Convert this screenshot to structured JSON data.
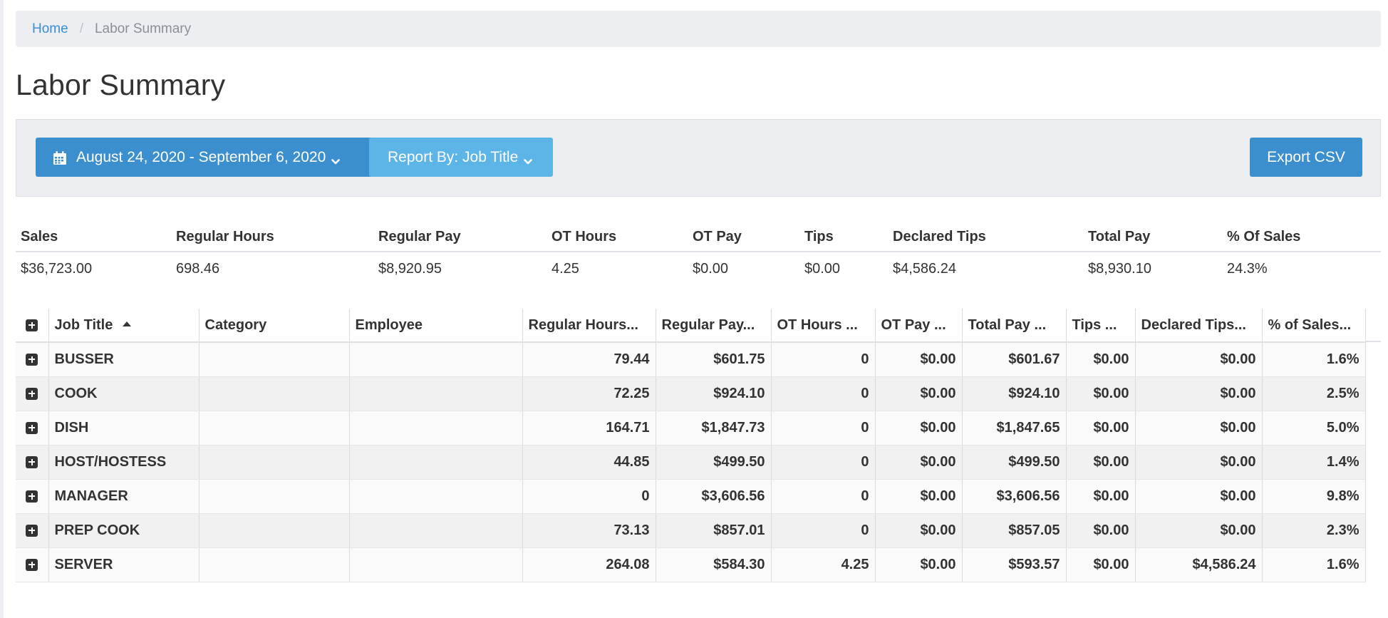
{
  "breadcrumb": {
    "home": "Home",
    "current": "Labor Summary"
  },
  "page_title": "Labor Summary",
  "toolbar": {
    "date_range": "August 24, 2020 - September 6, 2020",
    "report_by": "Report By: Job Title",
    "export": "Export CSV"
  },
  "summary": {
    "headers": [
      "Sales",
      "Regular Hours",
      "Regular Pay",
      "OT Hours",
      "OT Pay",
      "Tips",
      "Declared Tips",
      "Total Pay",
      "% Of Sales"
    ],
    "values": [
      "$36,723.00",
      "698.46",
      "$8,920.95",
      "4.25",
      "$0.00",
      "$0.00",
      "$4,586.24",
      "$8,930.10",
      "24.3%"
    ]
  },
  "grid": {
    "headers": [
      "Job Title",
      "Category",
      "Employee",
      "Regular Hours...",
      "Regular Pay...",
      "OT Hours ...",
      "OT Pay ...",
      "Total Pay ...",
      "Tips ...",
      "Declared Tips...",
      "% of Sales..."
    ],
    "rows": [
      [
        "BUSSER",
        "",
        "",
        "79.44",
        "$601.75",
        "0",
        "$0.00",
        "$601.67",
        "$0.00",
        "$0.00",
        "1.6%"
      ],
      [
        "COOK",
        "",
        "",
        "72.25",
        "$924.10",
        "0",
        "$0.00",
        "$924.10",
        "$0.00",
        "$0.00",
        "2.5%"
      ],
      [
        "DISH",
        "",
        "",
        "164.71",
        "$1,847.73",
        "0",
        "$0.00",
        "$1,847.65",
        "$0.00",
        "$0.00",
        "5.0%"
      ],
      [
        "HOST/HOSTESS",
        "",
        "",
        "44.85",
        "$499.50",
        "0",
        "$0.00",
        "$499.50",
        "$0.00",
        "$0.00",
        "1.4%"
      ],
      [
        "MANAGER",
        "",
        "",
        "0",
        "$3,606.56",
        "0",
        "$0.00",
        "$3,606.56",
        "$0.00",
        "$0.00",
        "9.8%"
      ],
      [
        "PREP COOK",
        "",
        "",
        "73.13",
        "$857.01",
        "0",
        "$0.00",
        "$857.05",
        "$0.00",
        "$0.00",
        "2.3%"
      ],
      [
        "SERVER",
        "",
        "",
        "264.08",
        "$584.30",
        "4.25",
        "$0.00",
        "$593.57",
        "$0.00",
        "$4,586.24",
        "1.6%"
      ]
    ]
  },
  "icons": {
    "calendar": "calendar-icon",
    "chevron": "chevron-down-icon",
    "expand": "plus-square-icon",
    "sort": "sort-asc-icon"
  },
  "colors": {
    "primary": "#3b8fcf",
    "secondary": "#5db4e6",
    "panel": "#eceef1"
  }
}
